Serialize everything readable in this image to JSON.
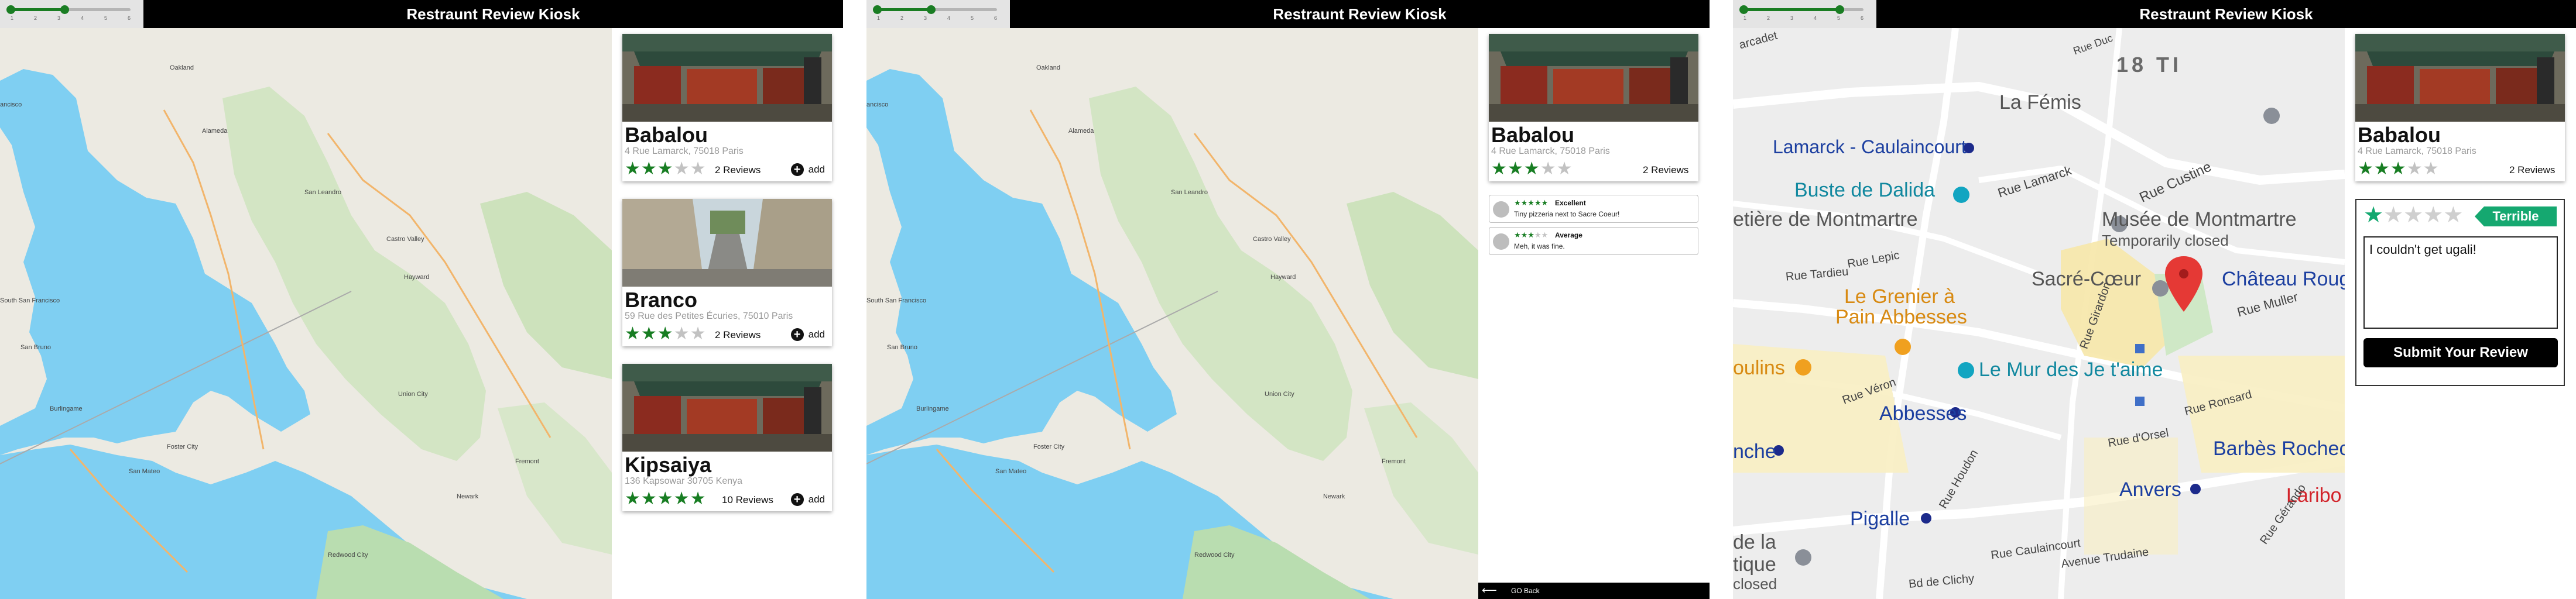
{
  "app": {
    "title": "Restraunt Review Kiosk",
    "zoom_ticks": [
      "1",
      "2",
      "3",
      "4",
      "5",
      "6"
    ],
    "accent_color": "#177d22"
  },
  "screens": [
    {
      "zoom_level_fraction": 0.45,
      "map": {
        "type": "regional",
        "labels": [
          "Oakland",
          "Alameda",
          "San Leandro",
          "Castro Valley",
          "Hayward",
          "Union City",
          "Fremont",
          "Newark",
          "Foster City",
          "San Mateo",
          "Burlingame",
          "Redwood City",
          "South San Francisco",
          "San Bruno",
          "ancisco"
        ]
      },
      "restaurants": [
        {
          "name": "Babalou",
          "address": "4 Rue Lamarck, 75018 Paris",
          "rating": 3,
          "reviews_label": "2 Reviews",
          "add_label": "add",
          "add_icon": "plus-circle-icon"
        },
        {
          "name": "Branco",
          "address": "59 Rue des Petites Écuries, 75010 Paris",
          "rating": 3,
          "reviews_label": "2 Reviews",
          "add_label": "add",
          "add_icon": "plus-circle-icon"
        },
        {
          "name": "Kipsaiya",
          "address": "136 Kapsowar 30705 Kenya",
          "rating": 5,
          "reviews_label": "10 Reviews",
          "add_label": "add",
          "add_icon": "plus-circle-icon"
        }
      ]
    },
    {
      "zoom_level_fraction": 0.45,
      "restaurant": {
        "name": "Babalou",
        "address": "4 Rue Lamarck, 75018 Paris",
        "rating": 3,
        "reviews_label": "2 Reviews"
      },
      "reviews": [
        {
          "rating": 5,
          "rating_label": "Excellent",
          "text": "Tiny pizzeria next to Sacre Coeur!"
        },
        {
          "rating": 3,
          "rating_label": "Average",
          "text": "Meh, it was fine."
        }
      ],
      "back_label": "GO Back",
      "back_icon": "arrow-left-icon"
    },
    {
      "zoom_level_fraction": 0.8,
      "map": {
        "type": "street",
        "labels": [
          "Rue Duc",
          "18 TI",
          "La Fémis",
          "Lamarck - Caulaincourt",
          "Rue Lamarck",
          "Rue Custine",
          "Buste de Dalida",
          "etière de Montmartre",
          "Musée de Montmartre",
          "Temporarily closed",
          "Sacré-Cœur",
          "Château Roug",
          "Le Grenier à",
          "Pain Abbesses",
          "Rue Muller",
          "oulins",
          "Le Mur des Je t'aime",
          "Abbesses",
          "Barbès Rochecho",
          "Anvers",
          "nche",
          "Pigalle",
          "Laribo",
          "de la",
          "tique",
          "closed",
          "Rue Lepic",
          "Rue Véron",
          "Rue d'Orsel",
          "Rue Houdon",
          "Rue Caulaincourt",
          "Rue Ronsard",
          "Rue Gérando",
          "Bd de Clichy",
          "Avenue Trudaine",
          "Rue Tardieu",
          "Rue Girardon",
          "arcadet"
        ]
      },
      "restaurant": {
        "name": "Babalou",
        "address": "4 Rue Lamarck, 75018 Paris",
        "rating": 3,
        "reviews_label": "2 Reviews"
      },
      "review_form": {
        "rating": 1,
        "rating_label": "Terrible",
        "text": "I couldn't get ugali!",
        "submit_label": "Submit Your Review",
        "tag_color": "#15a870"
      }
    }
  ]
}
